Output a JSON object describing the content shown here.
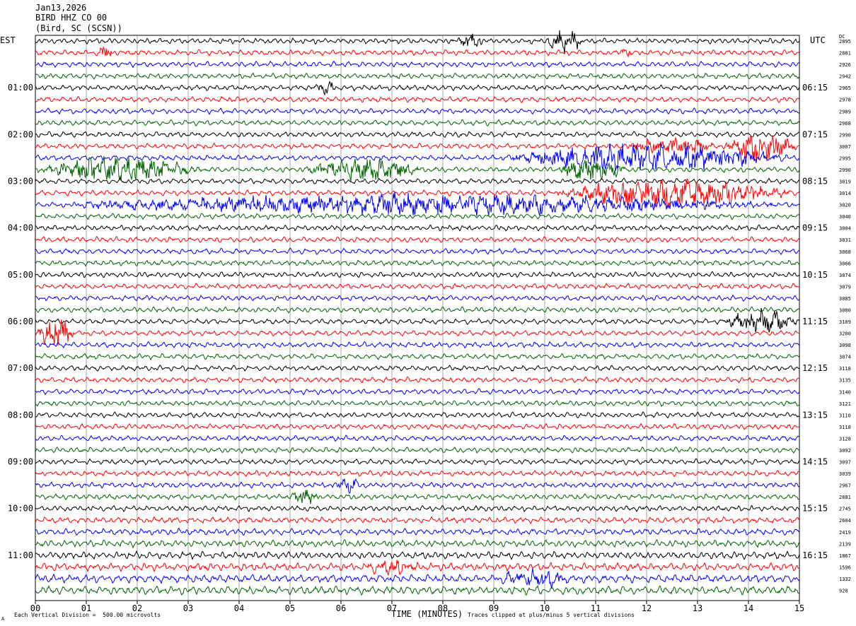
{
  "header": {
    "date": "Jan13,2026",
    "station": "BIRD HHZ CO 00",
    "location": "(Bird, SC (SCSN))"
  },
  "labels": {
    "left_tz": "EST",
    "right_tz": "UTC",
    "dc": "DC",
    "xlabel": "TIME (MINUTES)",
    "footer_left": "Each Vertical Division =  500.00 microvolts",
    "footer_right": "Traces clipped at plus/minus 5 vertical divisions",
    "corner_mark": "A"
  },
  "colors": {
    "cycle": [
      "#000000",
      "#ff0000",
      "#0000ff",
      "#006400"
    ],
    "grid": "#808080"
  },
  "chart_data": {
    "type": "line",
    "title": "BIRD HHZ CO 00",
    "xlabel": "TIME (MINUTES)",
    "xlim": [
      0,
      15
    ],
    "x_ticks": [
      "00",
      "01",
      "02",
      "03",
      "04",
      "05",
      "06",
      "07",
      "08",
      "09",
      "10",
      "11",
      "12",
      "13",
      "14",
      "15"
    ],
    "row_count": 48,
    "left_hour_labels": [
      "01:00",
      "02:00",
      "03:00",
      "04:00",
      "05:00",
      "06:00",
      "07:00",
      "08:00",
      "09:00",
      "10:00",
      "11:00"
    ],
    "right_hour_labels": [
      "06:15",
      "07:15",
      "08:15",
      "09:15",
      "10:15",
      "11:15",
      "12:15",
      "13:15",
      "14:15",
      "15:15",
      "16:15"
    ],
    "dc_offsets": [
      2895,
      2881,
      2926,
      2942,
      2965,
      2978,
      2989,
      2968,
      2990,
      3007,
      2995,
      2990,
      3019,
      3014,
      3020,
      3040,
      3004,
      3031,
      3068,
      3066,
      3074,
      3079,
      3085,
      3080,
      3109,
      3200,
      3098,
      3074,
      3118,
      3135,
      3140,
      3121,
      3110,
      3118,
      3128,
      3092,
      3097,
      3039,
      2967,
      2881,
      2745,
      2604,
      2419,
      2139,
      1867,
      1596,
      1332,
      920
    ],
    "events": [
      {
        "row": 0,
        "start": 8.3,
        "end": 8.8,
        "amp": 2.0
      },
      {
        "row": 0,
        "start": 10.0,
        "end": 10.8,
        "amp": 2.5
      },
      {
        "row": 1,
        "start": 1.2,
        "end": 1.6,
        "amp": 1.4
      },
      {
        "row": 1,
        "start": 11.5,
        "end": 11.7,
        "amp": 1.4
      },
      {
        "row": 4,
        "start": 5.5,
        "end": 5.9,
        "amp": 1.5
      },
      {
        "row": 9,
        "start": 11.5,
        "end": 13.5,
        "amp": 1.8
      },
      {
        "row": 9,
        "start": 13.5,
        "end": 15.0,
        "amp": 3.5
      },
      {
        "row": 10,
        "start": 9.0,
        "end": 15.0,
        "amp": 3.0
      },
      {
        "row": 11,
        "start": 0.0,
        "end": 3.3,
        "amp": 2.8
      },
      {
        "row": 11,
        "start": 5.2,
        "end": 7.6,
        "amp": 2.6
      },
      {
        "row": 11,
        "start": 10.2,
        "end": 11.6,
        "amp": 2.6
      },
      {
        "row": 13,
        "start": 10.0,
        "end": 15.0,
        "amp": 3.2
      },
      {
        "row": 14,
        "start": 0.0,
        "end": 15.0,
        "amp": 2.2
      },
      {
        "row": 24,
        "start": 13.5,
        "end": 15.0,
        "amp": 2.5
      },
      {
        "row": 25,
        "start": 0.0,
        "end": 0.8,
        "amp": 3.5
      },
      {
        "row": 38,
        "start": 5.9,
        "end": 6.4,
        "amp": 1.8
      },
      {
        "row": 39,
        "start": 5.0,
        "end": 5.6,
        "amp": 1.6
      },
      {
        "row": 45,
        "start": 6.4,
        "end": 7.6,
        "amp": 1.5
      },
      {
        "row": 46,
        "start": 9.0,
        "end": 10.5,
        "amp": 1.8
      }
    ]
  }
}
